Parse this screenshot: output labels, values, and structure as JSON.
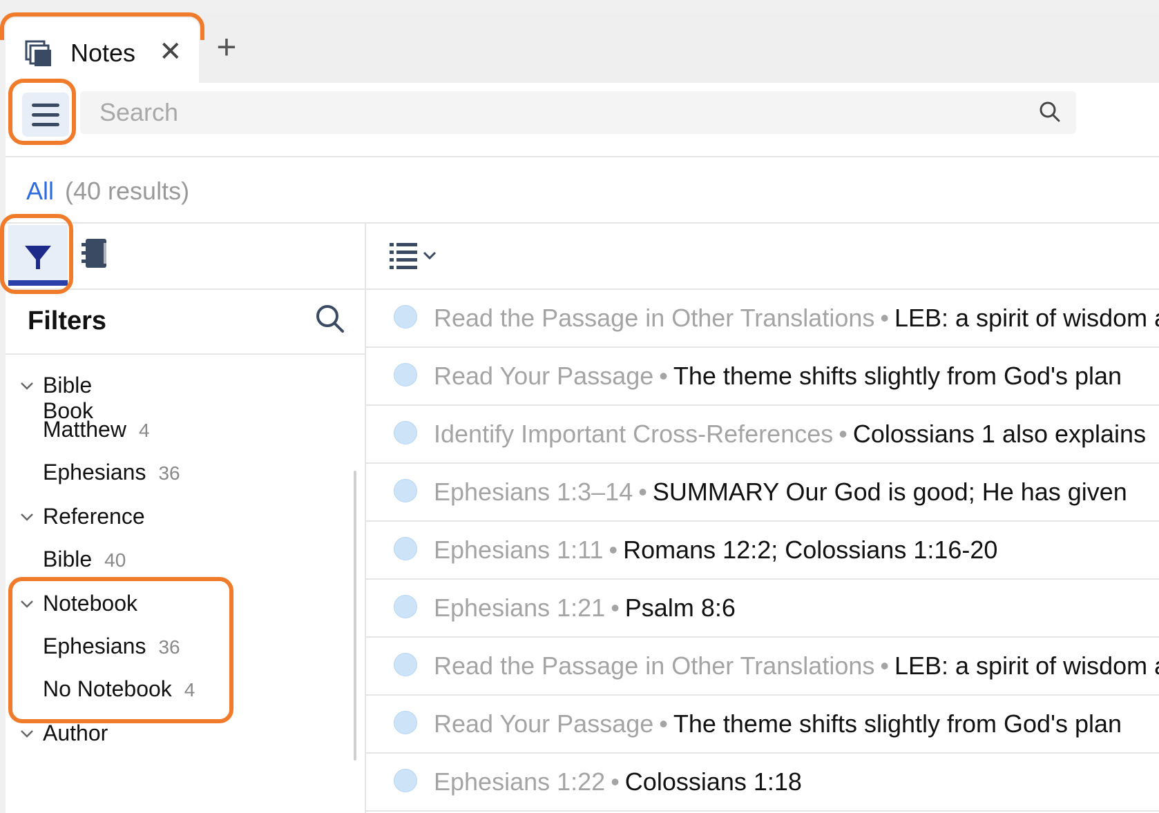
{
  "tab": {
    "label": "Notes",
    "close": "✕",
    "add": "+"
  },
  "search": {
    "placeholder": "Search"
  },
  "results": {
    "all": "All",
    "count": "(40 results)"
  },
  "filters": {
    "title": "Filters",
    "groups": [
      {
        "label": "Bible Book",
        "items": [
          {
            "label": "Matthew",
            "count": "4"
          },
          {
            "label": "Ephesians",
            "count": "36"
          }
        ]
      },
      {
        "label": "Reference",
        "items": [
          {
            "label": "Bible",
            "count": "40"
          }
        ]
      },
      {
        "label": "Notebook",
        "items": [
          {
            "label": "Ephesians",
            "count": "36"
          },
          {
            "label": "No Notebook",
            "count": "4"
          }
        ]
      },
      {
        "label": "Author",
        "items": []
      }
    ]
  },
  "notes": [
    {
      "source": "Read the Passage in Other Translations",
      "text": "LEB: a spirit of wisdom and revelation"
    },
    {
      "source": "Read Your Passage",
      "text": "The theme shifts slightly from God's plan"
    },
    {
      "source": "Identify Important Cross-References",
      "text": "Colossians 1 also explains"
    },
    {
      "source": "Ephesians 1:3–14",
      "text": "SUMMARY Our God is good; He has given"
    },
    {
      "source": "Ephesians 1:11",
      "text": "Romans 12:2; Colossians 1:16-20"
    },
    {
      "source": "Ephesians 1:21",
      "text": "Psalm 8:6"
    },
    {
      "source": "Read the Passage in Other Translations",
      "text": "LEB: a spirit of wisdom and revelation"
    },
    {
      "source": "Read Your Passage",
      "text": "The theme shifts slightly from God's plan"
    },
    {
      "source": "Ephesians 1:22",
      "text": "Colossians 1:18"
    }
  ],
  "icons": {
    "tab": "notes-stack-icon",
    "menu": "hamburger-icon",
    "search": "search-icon",
    "filter": "funnel-icon",
    "notebook": "notebook-icon",
    "view": "list-view-icon",
    "chevron": "chevron-down-icon",
    "dot": "note-dot-icon"
  },
  "colors": {
    "accent": "#2d6cdf",
    "highlight": "#f07b2a",
    "filter_active": "#2b3fa8",
    "dot": "#cce3f8"
  }
}
